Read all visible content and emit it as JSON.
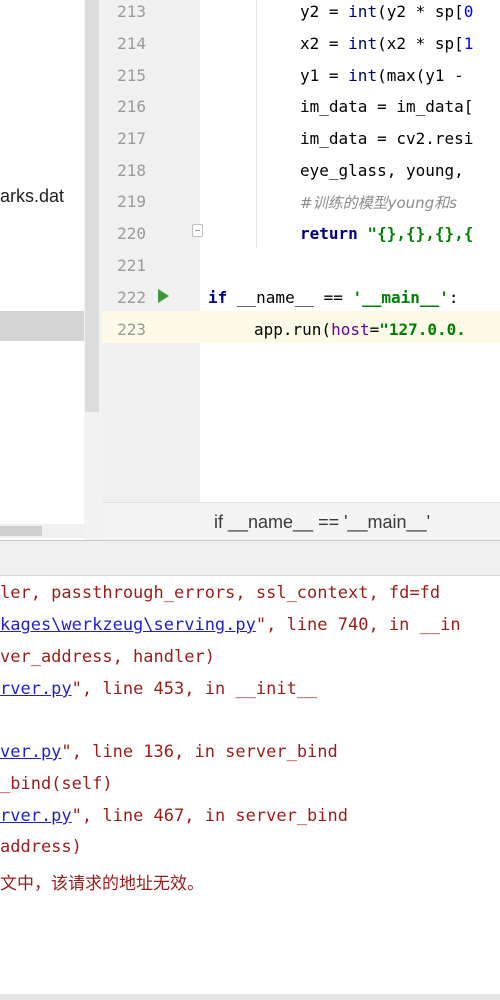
{
  "project_tree": {
    "file_partial": "arks.dat"
  },
  "editor": {
    "line_numbers": [
      "213",
      "214",
      "215",
      "216",
      "217",
      "218",
      "219",
      "220",
      "221",
      "222",
      "223"
    ],
    "lines": {
      "l213": {
        "pre": "y2 = ",
        "fn": "int",
        "mid": "(y2 * sp[",
        "num": "0"
      },
      "l214": {
        "pre": "x2 = ",
        "fn": "int",
        "mid": "(x2 * sp[",
        "num": "1"
      },
      "l215": {
        "pre": "y1 = ",
        "fn": "int",
        "mid": "(max(y1 - "
      },
      "l216": {
        "text": "im_data = im_data["
      },
      "l217": {
        "text": "im_data = cv2.resi"
      },
      "l218": {
        "text": "eye_glass, young, "
      },
      "l219": {
        "comment": "#训练的模型young和s"
      },
      "l220": {
        "kw": "return",
        "str": " \"{},{},{},{"
      },
      "l222": {
        "kw": "if",
        "name1": " __name__",
        "op": " == ",
        "str": "'__main__'",
        "tail": ":"
      },
      "l223": {
        "pre": "app.run(",
        "kwarg": "host",
        "eq": "=",
        "str": "\"127.0.0."
      }
    },
    "breadcrumb": "if __name__ == '__main__'"
  },
  "console": {
    "lines": {
      "c1": "ler, passthrough_errors, ssl_context, fd=fd",
      "c2_link": "kages\\werkzeug\\serving.py",
      "c2_tail": "\", line 740, in __in",
      "c3": "ver_address, handler)",
      "c4_link": "rver.py",
      "c4_tail": "\", line 453, in __init__",
      "c6_link": "ver.py",
      "c6_tail": "\", line 136, in server_bind",
      "c7": "_bind(self)",
      "c8_link": "rver.py",
      "c8_tail": "\", line 467, in server_bind",
      "c9": "address)",
      "c10": "文中，该请求的地址无效。"
    }
  },
  "colors": {
    "keyword": "#000080",
    "string": "#008000",
    "number": "#0000ff",
    "error_text": "#9b1c1c",
    "link": "#2222cc",
    "run_icon": "#3c9a3a"
  },
  "icons": {
    "run": "play-triangle-icon",
    "fold": "fold-marker-icon"
  }
}
